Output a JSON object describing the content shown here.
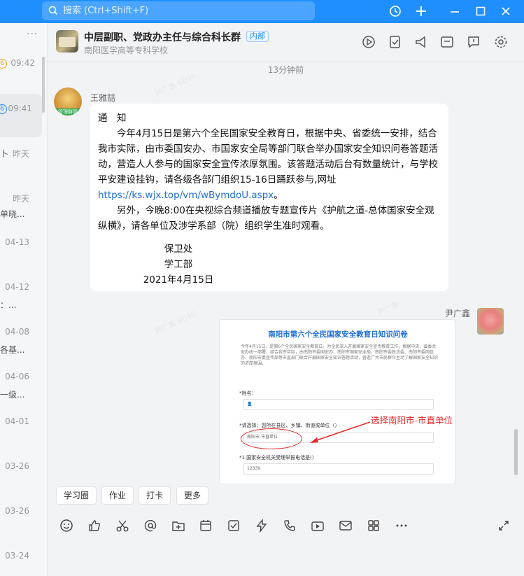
{
  "titlebar": {
    "search_placeholder": "搜索 (Ctrl+Shift+F)",
    "search_icon": "search-icon",
    "history_icon": "history-icon",
    "add_icon": "plus-icon",
    "minimize_icon": "minimize-icon",
    "maximize_icon": "maximize-icon",
    "close_icon": "close-icon"
  },
  "conversation_list": {
    "more": "···",
    "items": [
      {
        "time": "09:42",
        "snippet": "",
        "badge": "6"
      },
      {
        "time": "09:41",
        "snippet": "",
        "badge": "6"
      },
      {
        "time": "昨天",
        "snippet": "卜"
      },
      {
        "time": "昨天",
        "snippet": "单晓..."
      },
      {
        "time": "04-13",
        "snippet": ""
      },
      {
        "time": "04-12",
        "snippet": "：..."
      },
      {
        "time": "04-08",
        "snippet": "各基..."
      },
      {
        "time": "04-06",
        "snippet": "一级..."
      },
      {
        "time": "04-01",
        "snippet": ""
      },
      {
        "time": "03-26",
        "snippet": ""
      },
      {
        "time": "03-26",
        "snippet": ""
      },
      {
        "time": "03-24",
        "snippet": ""
      }
    ]
  },
  "header": {
    "group_name": "中层副职、党政办主任与综合科长群",
    "group_tag": "内部",
    "org_name": "南阳医学高等专科学校",
    "icons": [
      "replay-icon",
      "todo-icon",
      "announcement-icon",
      "docs-icon",
      "message-icon",
      "settings-icon"
    ]
  },
  "chat": {
    "time_separator": "13分钟前",
    "message1": {
      "sender": "王雅喆",
      "badge": "管理群管",
      "lines": {
        "heading": "通　知",
        "p1": "　　今年4月15日是第六个全民国家安全教育日，根据中央、省委统一安排，结合我市实际，由市委国安办、市国家安全局等部门联合举办国家安全知识问卷答题活动，营造人人参与的国家安全宣传浓厚氛围。该答题活动后台有数量统计，与学校平安建设挂钩，请各级各部门组织15-16日踊跃参与,网址",
        "link": "https://ks.wjx.top/vm/wBymdoU.aspx",
        "p1_end": "。",
        "p2": "　　另外，今晚8:00在央视综合频道播放专题宣传片《护航之道-总体国家安全观纵横》，请各单位及涉学系部（院）组织学生准时观看。",
        "sig1": "保卫处",
        "sig2": "学工部",
        "sig3": "2021年4月15日"
      }
    },
    "message2": {
      "sender": "尹广鑫",
      "form_title": "南阳市第六个全民国家安全教育日知识问卷",
      "form_desc": "今年4月15日，是第6个全民国家安全教育日。为全民深入开展国家安全宣传教育工作，根据中央、省委关安办统一部署，结合我市实际，由南阳市委国安办、南阳市国家安全局、南阳市委政法委、南阳市委网信办、南阳市委宣传部等市直部门联合开展国家安全知识答题活动，营造广大市民群众主动了解国家安全知识的浓厚氛围。",
      "q1": "*姓名：",
      "q2": "*请选择：您所在县区、乡镇、街道或单位（）",
      "q2_value": "南阳市-市直单位",
      "q3": "*1.国家安全机关受理举报电话是()",
      "q3_option": "12339",
      "annotation": "选择南阳市-市直单位"
    }
  },
  "quick_actions": [
    "学习圈",
    "作业",
    "打卡",
    "更多"
  ],
  "toolbar_icons": [
    "emoji-icon",
    "like-icon",
    "scissors-icon",
    "mention-icon",
    "add-folder-icon",
    "schedule-icon",
    "check-icon",
    "flash-icon",
    "call-icon",
    "live-icon",
    "mail-icon",
    "apps-icon",
    "more-icon",
    "expand-icon"
  ],
  "colors": {
    "accent": "#1f8fff",
    "annotation": "#e8292b",
    "link": "#1f6fd6"
  }
}
